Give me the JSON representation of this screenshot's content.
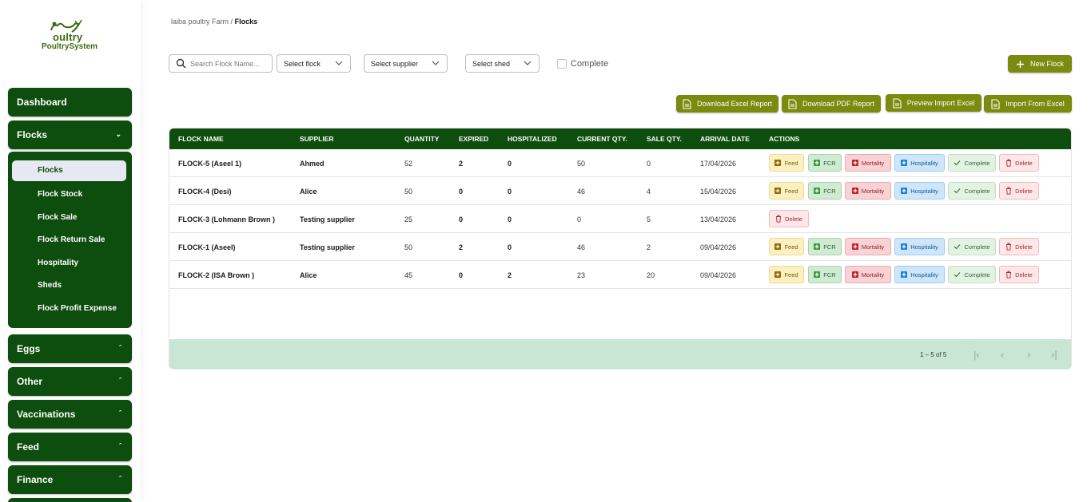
{
  "logo": {
    "line1": "oultry",
    "line2": "PoultrySystem"
  },
  "sidebar": {
    "dashboard": "Dashboard",
    "flocks": "Flocks",
    "flocks_sub": [
      "Flocks",
      "Flock Stock",
      "Flock Sale",
      "Flock Return Sale",
      "Hospitality",
      "Sheds",
      "Flock Profit Expense"
    ],
    "eggs": "Eggs",
    "other": "Other",
    "vaccinations": "Vaccinations",
    "feed": "Feed",
    "finance": "Finance"
  },
  "breadcrumb": {
    "farm": "laiba poultry Farm",
    "sep": "/",
    "current": "Flocks"
  },
  "filters": {
    "search_placeholder": "Search Flock Name...",
    "flock": "Select flock",
    "supplier": "Select supplier",
    "shed": "Select shed",
    "complete": "Complete"
  },
  "buttons": {
    "new_flock": "New Flock",
    "excel": "Download Excel Report",
    "pdf": "Download PDF Report",
    "preview": "Preview Import Excel",
    "import": "Import From Excel"
  },
  "table": {
    "headers": [
      "FLOCK NAME",
      "SUPPLIER",
      "QUANTITY",
      "EXPIRED",
      "HOSPITALIZED",
      "CURRENT QTY.",
      "SALE QTY.",
      "ARRIVAL DATE",
      "ACTIONS"
    ],
    "rows": [
      {
        "name": "FLOCK-5 (Aseel 1)",
        "supplier": "Ahmed",
        "quantity": "52",
        "expired": "2",
        "hospitalized": "0",
        "current": "50",
        "sale": "0",
        "date": "17/04/2026"
      },
      {
        "name": "FLOCK-4 (Desi)",
        "supplier": "Alice",
        "quantity": "50",
        "expired": "0",
        "hospitalized": "0",
        "current": "46",
        "sale": "4",
        "date": "15/04/2026"
      },
      {
        "name": "FLOCK-3 (Lohmann Brown )",
        "supplier": "Testing supplier",
        "quantity": "25",
        "expired": "0",
        "hospitalized": "0",
        "current": "0",
        "sale": "5",
        "date": "13/04/2026"
      },
      {
        "name": "FLOCK-1 (Aseel)",
        "supplier": "Testing supplier",
        "quantity": "50",
        "expired": "2",
        "hospitalized": "0",
        "current": "46",
        "sale": "2",
        "date": "09/04/2026"
      },
      {
        "name": "FLOCK-2 (ISA Brown )",
        "supplier": "Alice",
        "quantity": "45",
        "expired": "0",
        "hospitalized": "2",
        "current": "23",
        "sale": "20",
        "date": "09/04/2026"
      }
    ],
    "actions": {
      "feed": "Feed",
      "fcr": "FCR",
      "mortality": "Mortality",
      "hospitality": "Hospitality",
      "complete": "Complete",
      "delete": "Delete"
    },
    "pagination": {
      "range": "1 – 5 of 5"
    }
  },
  "colors": {
    "primary": "#0d4d0d",
    "accent": "#7a8c0f",
    "footer": "#c8e6d3"
  }
}
